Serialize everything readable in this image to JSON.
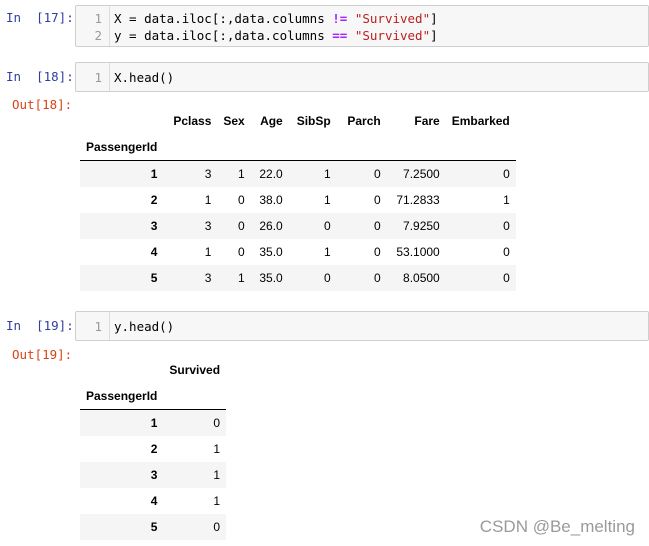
{
  "cells": [
    {
      "in_prompt": "In  [17]:",
      "lines": [
        {
          "no": "1",
          "parts": [
            [
              "X = data.iloc[:,data.columns ",
              ""
            ],
            [
              "!=",
              "op"
            ],
            [
              " ",
              ""
            ],
            [
              "\"Survived\"",
              "str"
            ],
            [
              "]",
              ""
            ]
          ]
        },
        {
          "no": "2",
          "parts": [
            [
              "y = data.iloc[:,data.columns ",
              ""
            ],
            [
              "==",
              "op"
            ],
            [
              " ",
              ""
            ],
            [
              "\"Survived\"",
              "str"
            ],
            [
              "]",
              ""
            ]
          ]
        }
      ]
    },
    {
      "in_prompt": "In  [18]:",
      "out_prompt": "Out[18]:",
      "lines": [
        {
          "no": "1",
          "parts": [
            [
              "X.head()",
              ""
            ]
          ]
        }
      ],
      "table": {
        "columns": [
          "Pclass",
          "Sex",
          "Age",
          "SibSp",
          "Parch",
          "Fare",
          "Embarked"
        ],
        "index_name": "PassengerId",
        "rows": [
          {
            "idx": "1",
            "cells": [
              "3",
              "1",
              "22.0",
              "1",
              "0",
              "7.2500",
              "0"
            ]
          },
          {
            "idx": "2",
            "cells": [
              "1",
              "0",
              "38.0",
              "1",
              "0",
              "71.2833",
              "1"
            ]
          },
          {
            "idx": "3",
            "cells": [
              "3",
              "0",
              "26.0",
              "0",
              "0",
              "7.9250",
              "0"
            ]
          },
          {
            "idx": "4",
            "cells": [
              "1",
              "0",
              "35.0",
              "1",
              "0",
              "53.1000",
              "0"
            ]
          },
          {
            "idx": "5",
            "cells": [
              "3",
              "1",
              "35.0",
              "0",
              "0",
              "8.0500",
              "0"
            ]
          }
        ]
      }
    },
    {
      "in_prompt": "In  [19]:",
      "out_prompt": "Out[19]:",
      "lines": [
        {
          "no": "1",
          "parts": [
            [
              "y.head()",
              ""
            ]
          ]
        }
      ],
      "table": {
        "columns": [
          "Survived"
        ],
        "index_name": "PassengerId",
        "rows": [
          {
            "idx": "1",
            "cells": [
              "0"
            ]
          },
          {
            "idx": "2",
            "cells": [
              "1"
            ]
          },
          {
            "idx": "3",
            "cells": [
              "1"
            ]
          },
          {
            "idx": "4",
            "cells": [
              "1"
            ]
          },
          {
            "idx": "5",
            "cells": [
              "0"
            ]
          }
        ]
      }
    }
  ],
  "watermark": "CSDN @Be_melting",
  "colors": {
    "in_prompt": "#303f9f",
    "out_prompt": "#d84315",
    "operator": "#aa22ff",
    "string": "#ba2121"
  }
}
